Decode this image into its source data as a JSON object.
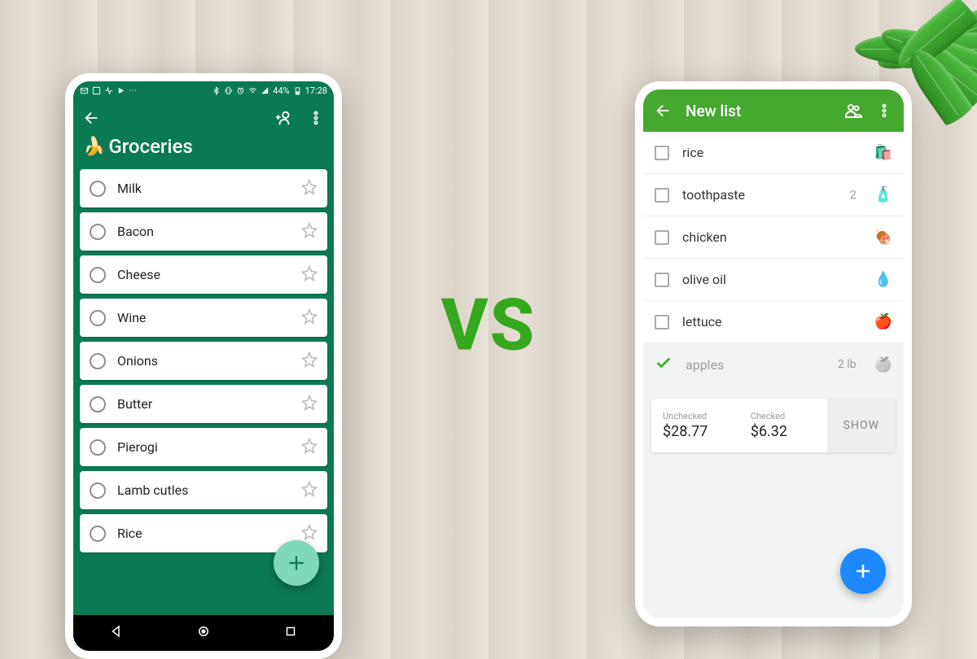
{
  "vs_label": "VS",
  "left": {
    "status": {
      "battery": "44%",
      "time": "17:28"
    },
    "title": "Groceries",
    "items": [
      {
        "name": "Milk"
      },
      {
        "name": "Bacon"
      },
      {
        "name": "Cheese"
      },
      {
        "name": "Wine"
      },
      {
        "name": "Onions"
      },
      {
        "name": "Butter"
      },
      {
        "name": "Pierogi"
      },
      {
        "name": "Lamb cutles"
      },
      {
        "name": "Rice"
      }
    ]
  },
  "right": {
    "title": "New list",
    "items": [
      {
        "name": "rice",
        "qty": "",
        "icon": "🛍️",
        "checked": false
      },
      {
        "name": "toothpaste",
        "qty": "2",
        "icon": "🧴",
        "checked": false
      },
      {
        "name": "chicken",
        "qty": "",
        "icon": "🍖",
        "checked": false
      },
      {
        "name": "olive oil",
        "qty": "",
        "icon": "💧",
        "checked": false
      },
      {
        "name": "lettuce",
        "qty": "",
        "icon": "🍎",
        "checked": false
      },
      {
        "name": "apples",
        "qty": "2 lb",
        "icon": "🍏",
        "checked": true
      }
    ],
    "totals": {
      "unchecked_label": "Unchecked",
      "unchecked_value": "$28.77",
      "checked_label": "Checked",
      "checked_value": "$6.32",
      "show_label": "SHOW"
    }
  }
}
